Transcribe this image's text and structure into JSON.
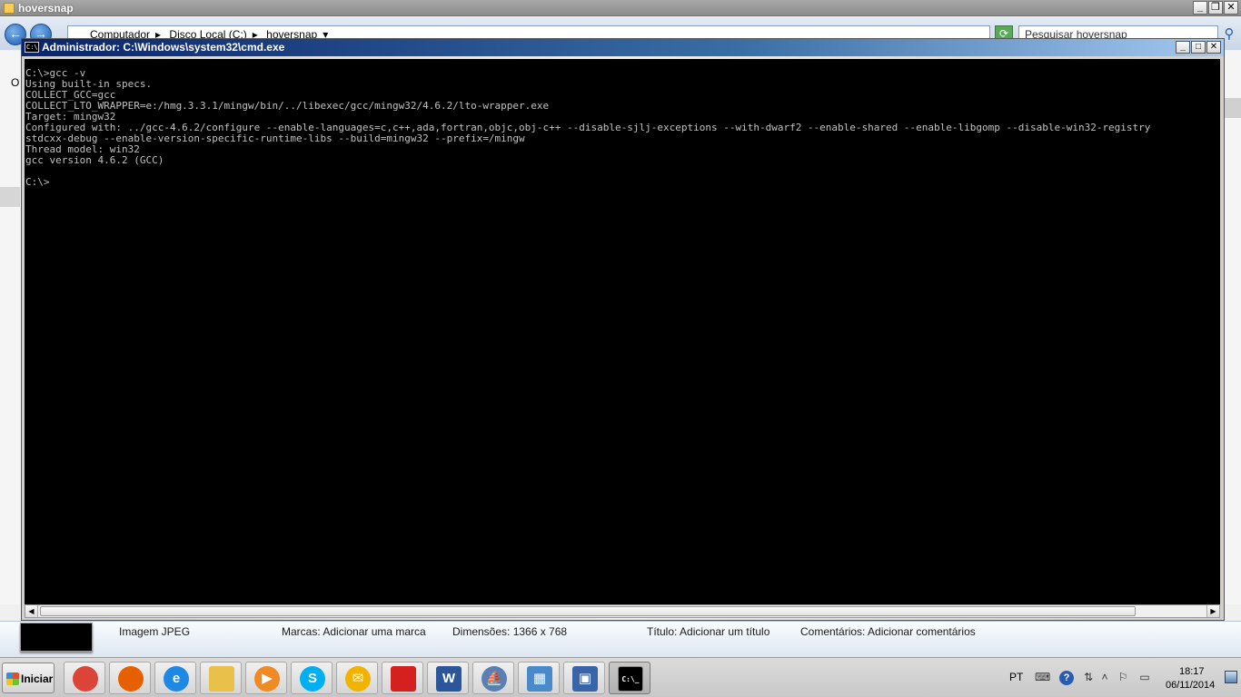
{
  "explorer": {
    "title": "hoversnap",
    "address_segments": [
      "Computador",
      "Disco Local (C:)",
      "hoversnap"
    ],
    "search_placeholder": "Pesquisar hoversnap",
    "left_letter": "O",
    "details": {
      "file_type": "Imagem JPEG",
      "tags": "Marcas: Adicionar uma marca",
      "dimensions": "Dimensões: 1366 x 768",
      "title": "Título: Adicionar um título",
      "comments": "Comentários: Adicionar comentários"
    }
  },
  "cmd": {
    "title": "Administrador: C:\\Windows\\system32\\cmd.exe",
    "icon_text": "C:\\",
    "lines": [
      "C:\\>gcc -v",
      "Using built-in specs.",
      "COLLECT_GCC=gcc",
      "COLLECT_LTO_WRAPPER=e:/hmg.3.3.1/mingw/bin/../libexec/gcc/mingw32/4.6.2/lto-wrapper.exe",
      "Target: mingw32",
      "Configured with: ../gcc-4.6.2/configure --enable-languages=c,c++,ada,fortran,objc,obj-c++ --disable-sjlj-exceptions --with-dwarf2 --enable-shared --enable-libgomp --disable-win32-registry",
      "stdcxx-debug --enable-version-specific-runtime-libs --build=mingw32 --prefix=/mingw",
      "Thread model: win32",
      "gcc version 4.6.2 (GCC)",
      "",
      "C:\\>"
    ]
  },
  "taskbar": {
    "start_label": "Iniciar",
    "apps": [
      {
        "name": "chrome",
        "glyph": "",
        "color": "#db4437"
      },
      {
        "name": "firefox",
        "glyph": "",
        "color": "#e66000"
      },
      {
        "name": "internet-explorer",
        "glyph": "e",
        "color": "#1e88e5"
      },
      {
        "name": "windows-explorer",
        "glyph": "",
        "color": "#e8c04a"
      },
      {
        "name": "media-player",
        "glyph": "▶",
        "color": "#f08a24"
      },
      {
        "name": "skype",
        "glyph": "S",
        "color": "#00aff0"
      },
      {
        "name": "outlook",
        "glyph": "✉",
        "color": "#f0b400"
      },
      {
        "name": "adobe-reader",
        "glyph": "",
        "color": "#d4201e"
      },
      {
        "name": "word",
        "glyph": "W",
        "color": "#2b579a"
      },
      {
        "name": "sailboat-app",
        "glyph": "⛵",
        "color": "#5a7fb0"
      },
      {
        "name": "control-panel",
        "glyph": "▦",
        "color": "#4a8ac8"
      },
      {
        "name": "remote-desktop",
        "glyph": "▣",
        "color": "#3a64a8"
      },
      {
        "name": "cmd",
        "glyph": "C:\\_",
        "color": "#000000"
      }
    ],
    "language": "PT",
    "help_glyph": "?",
    "time": "18:17",
    "date": "06/11/2014"
  }
}
